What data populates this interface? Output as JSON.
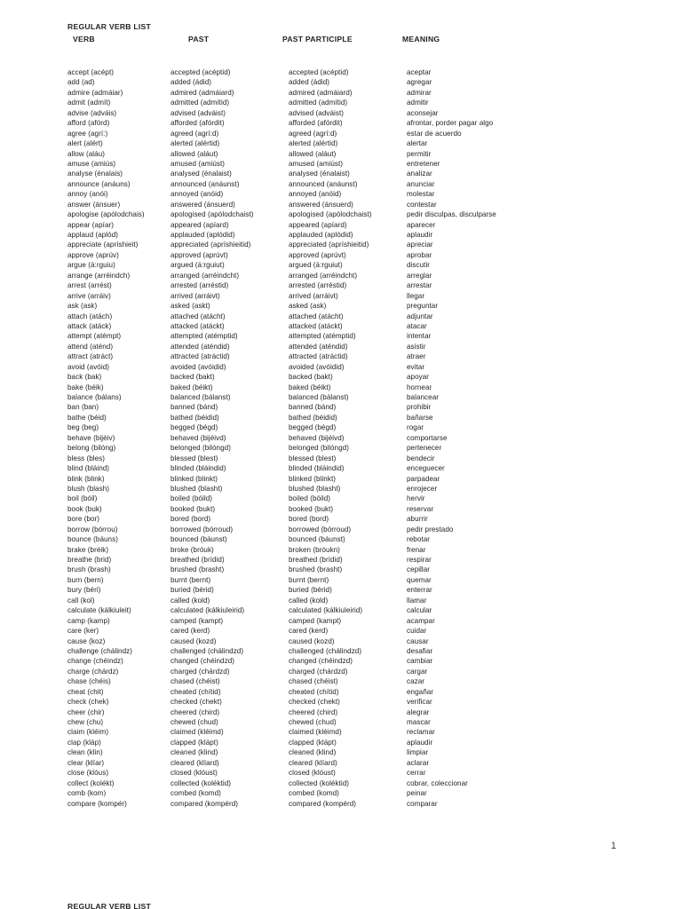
{
  "document": {
    "title": "REGULAR VERB LIST",
    "page_number": "1",
    "next_page_title": "REGULAR VERB LIST"
  },
  "columns": [
    "VERB",
    "PAST",
    "PAST PARTICIPLE",
    "MEANING"
  ],
  "rows": [
    [
      "accept (acépt)",
      "accepted (acéptid)",
      "accepted (acéptid)",
      "aceptar"
    ],
    [
      "add (ad)",
      "added (ádid)",
      "added (ádid)",
      "agregar"
    ],
    [
      "admire (admáiar)",
      "admired (admáiard)",
      "admired (admáiard)",
      "admirar"
    ],
    [
      "admit (admít)",
      "admitted (admítid)",
      "admitted (admítid)",
      "admitir"
    ],
    [
      "advise (adváis)",
      "advised (adváist)",
      "advised (adváist)",
      "aconsejar"
    ],
    [
      "afford (afórd)",
      "afforded (afórdit)",
      "afforded (afórdit)",
      "afrontar, porder pagar algo"
    ],
    [
      "agree (agrí:)",
      "agreed (agrí:d)",
      "agreed (agrí:d)",
      "estar de acuerdo"
    ],
    [
      "alert (alért)",
      "alerted (alértid)",
      "alerted (alértid)",
      "alertar"
    ],
    [
      "allow (aláu)",
      "allowed (aláut)",
      "allowed (aláut)",
      "permitir"
    ],
    [
      "amuse (amiús)",
      "amused (amiúst)",
      "amused (amiúst)",
      "entretener"
    ],
    [
      "analyse (énalais)",
      "analysed (énalaist)",
      "analysed (énalaist)",
      "analizar"
    ],
    [
      "announce (anáuns)",
      "announced (anáunst)",
      "announced (anáunst)",
      "anunciar"
    ],
    [
      "annoy (anói)",
      "annoyed (anóid)",
      "annoyed (anóid)",
      "molestar"
    ],
    [
      "answer (ánsuer)",
      "answered (ánsuerd)",
      "answered (ánsuerd)",
      "contestar"
    ],
    [
      "apologise (apólodchais)",
      "apologised (apólodchaist)",
      "apologised (apólodchaist)",
      "pedir disculpas, disculparse"
    ],
    [
      "appear (apíar)",
      "appeared (apíard)",
      "appeared (apíard)",
      "aparecer"
    ],
    [
      "applaud  (aplód)",
      "applauded (aplódid)",
      "applauded (aplódid)",
      "aplaudir"
    ],
    [
      "appreciate (apríshieit)",
      "appreciated (apríshieitid)",
      "appreciated (apríshieitid)",
      "apreciar"
    ],
    [
      "approve (aprúv)",
      "approved (aprúvt)",
      "approved (aprúvt)",
      "aprobar"
    ],
    [
      "argue (á:rguiu)",
      "argued (á:rguiut)",
      "argued (á:rguiut)",
      "discutir"
    ],
    [
      "arrange (arréindch)",
      "arranged (arréindcht)",
      "arranged (arréindcht)",
      "arreglar"
    ],
    [
      "arrest (arrést)",
      "arrested (arréstid)",
      "arrested (arréstid)",
      "arrestar"
    ],
    [
      "arrive (arráiv)",
      "arrived (arráivt)",
      "arrived (arráivt)",
      "llegar"
    ],
    [
      "ask  (ask)",
      "asked (askt)",
      "asked (ask)",
      "preguntar"
    ],
    [
      "attach (atách)",
      "attached (atácht)",
      "attached (atácht)",
      "adjuntar"
    ],
    [
      "attack (atáck)",
      "attacked (atáckt)",
      "attacked (atáckt)",
      "atacar"
    ],
    [
      "attempt (atémpt)",
      "attempted (atémptid)",
      "attempted (atémptid)",
      "intentar"
    ],
    [
      "attend (aténd)",
      "attended (aténdid)",
      "attended (aténdid)",
      "asistir"
    ],
    [
      "attract (atráct)",
      "attracted (atráctid)",
      "attracted (atráctid)",
      "atraer"
    ],
    [
      "avoid (avóid)",
      "avoided (avóidid)",
      "avoided (avóidid)",
      "evitar"
    ],
    [
      "back (bak)",
      "backed (bakt)",
      "backed (bakt)",
      "apoyar"
    ],
    [
      "bake (béik)",
      "baked (béikt)",
      "baked (béikt)",
      "hornear"
    ],
    [
      "balance (bálans)",
      "balanced (bálanst)",
      "balanced (bálanst)",
      "balancear"
    ],
    [
      "ban (ban)",
      "banned (bánd)",
      "banned (bánd)",
      "prohibir"
    ],
    [
      "bathe (béid)",
      "bathed (béidid)",
      "bathed (béidid)",
      "bañarse"
    ],
    [
      "beg (beg)",
      "begged (bégd)",
      "begged (bégd)",
      "rogar"
    ],
    [
      "behave (bijéiv)",
      "behaved (bijéivd)",
      "behaved (bijéivd)",
      "comportarse"
    ],
    [
      "belong (bilóng)",
      "belonged (bilóngd)",
      "belonged (bilóngd)",
      "pertenecer"
    ],
    [
      "bless (bles)",
      "blessed (blest)",
      "blessed (blest)",
      "bendecir"
    ],
    [
      "blind (bláind)",
      "blinded (bláindid)",
      "blinded (bláindid)",
      "enceguecer"
    ],
    [
      "blink (blink)",
      "blinked (blinkt)",
      "blinked (blinkt)",
      "parpadear"
    ],
    [
      "blush (blash)",
      "blushed (blasht)",
      "blushed (blasht)",
      "enrojecer"
    ],
    [
      "boil (bóil)",
      "boiled (bóild)",
      "boiled (bóild)",
      "hervir"
    ],
    [
      "book (buk)",
      "booked (bukt)",
      "booked (bukt)",
      "reservar"
    ],
    [
      "bore (bor)",
      "bored (bord)",
      "bored (bord)",
      "aburrir"
    ],
    [
      "borrow (bórrou)",
      "borrowed (bórroud)",
      "borrowed (bórroud)",
      "pedir prestado"
    ],
    [
      "bounce (báuns)",
      "bounced (báunst)",
      "bounced (báunst)",
      "rebotar"
    ],
    [
      "brake (bréik)",
      "broke (bróuk)",
      "broken (bróukn)",
      "frenar"
    ],
    [
      "breathe (brid)",
      "breathed (brídid)",
      "breathed (brídid)",
      "respirar"
    ],
    [
      "brush (brash)",
      "brushed (brasht)",
      "brushed (brasht)",
      "cepillar"
    ],
    [
      "burn (bern)",
      "burnt (bernt)",
      "burnt (bernt)",
      "quemar"
    ],
    [
      "bury (béri)",
      "buried (bérid)",
      "buried (bérid)",
      "enterrar"
    ],
    [
      "call (kol)",
      "called (kold)",
      "called (kold)",
      "llamar"
    ],
    [
      "calculate (kálkiuleit)",
      "calculated (kálkiuleirid)",
      "calculated (kálkiuleirid)",
      "calcular"
    ],
    [
      "camp (kamp)",
      "camped (kampt)",
      "camped (kampt)",
      "acampar"
    ],
    [
      "care (ker)",
      "cared (kerd)",
      "cared (kerd)",
      "cuidar"
    ],
    [
      "cause (koz)",
      "caused (kozd)",
      "caused (kozd)",
      "causar"
    ],
    [
      "challenge (chálindz)",
      "challenged (chálindzd)",
      "challenged (chálindzd)",
      "desafiar"
    ],
    [
      "change (chéindz)",
      "changed (chéindzd)",
      "changed (chéindzd)",
      "cambiar"
    ],
    [
      "charge (chárdz)",
      "charged (chárdzd)",
      "charged (chárdzd)",
      "cargar"
    ],
    [
      "chase (chéis)",
      "chased (chéist)",
      "chased (chéist)",
      "cazar"
    ],
    [
      "cheat (chit)",
      "cheated (chítid)",
      "cheated (chítid)",
      "engañar"
    ],
    [
      "check (chek)",
      "checked (chekt)",
      "checked (chekt)",
      "verificar"
    ],
    [
      "cheer (chir)",
      "cheered (chird)",
      "cheered (chird)",
      "alegrar"
    ],
    [
      "chew (chu)",
      "chewed (chud)",
      "chewed (chud)",
      "mascar"
    ],
    [
      "claim (kléim)",
      "claimed (kléimd)",
      "claimed (kléimd)",
      "reclamar"
    ],
    [
      "clap (kláp)",
      "clapped (klápt)",
      "clapped (klápt)",
      "aplaudir"
    ],
    [
      "clean (klin)",
      "cleaned (klind)",
      "cleaned (klind)",
      "limpiar"
    ],
    [
      "clear (klíar)",
      "cleared (klíard)",
      "cleared (klíard)",
      "aclarar"
    ],
    [
      "close (klóus)",
      "closed (klóust)",
      "closed (klóust)",
      "cerrar"
    ],
    [
      "collect (kolékt)",
      "collected (koléktid)",
      "collected (koléktid)",
      "cobrar, coleccionar"
    ],
    [
      "comb  (kom)",
      "combed (komd)",
      "combed (komd)",
      "peinar"
    ],
    [
      "compare (kompér)",
      "compared (kompérd)",
      "compared (kompérd)",
      "comparar"
    ]
  ]
}
